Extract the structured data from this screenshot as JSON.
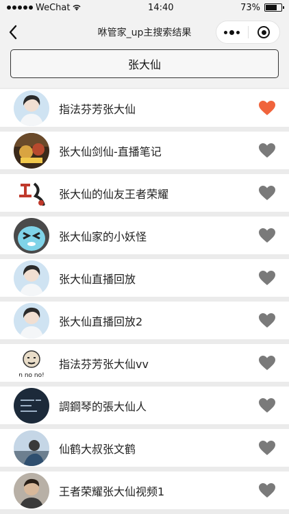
{
  "status": {
    "carrier": "WeChat",
    "time": "14:40",
    "battery": "73%",
    "battery_level": 0.73
  },
  "nav": {
    "title": "咻管家_up主搜索结果",
    "menu_icon": "more-dots-icon",
    "close_icon": "mini-program-close-icon"
  },
  "search": {
    "query": "张大仙"
  },
  "colors": {
    "heart_active": "#f0643c",
    "heart_inactive": "#7a7a7a"
  },
  "results": [
    {
      "name": "指法芬芳张大仙",
      "favorited": true,
      "avatar_icon": "portrait-avatar"
    },
    {
      "name": "张大仙剑仙-直播笔记",
      "favorited": false,
      "avatar_icon": "game-art-avatar"
    },
    {
      "name": "张大仙的仙友王者荣耀",
      "favorited": false,
      "avatar_icon": "calligraphy-avatar"
    },
    {
      "name": "张大仙家的小妖怪",
      "favorited": false,
      "avatar_icon": "cartoon-avatar"
    },
    {
      "name": "张大仙直播回放",
      "favorited": false,
      "avatar_icon": "portrait-avatar"
    },
    {
      "name": "张大仙直播回放2",
      "favorited": false,
      "avatar_icon": "portrait-avatar"
    },
    {
      "name": "指法芬芳张大仙vv",
      "favorited": false,
      "avatar_icon": "meme-avatar"
    },
    {
      "name": "調鋼琴的張大仙人",
      "favorited": false,
      "avatar_icon": "dark-text-avatar"
    },
    {
      "name": "仙鹤大叔张文鹤",
      "favorited": false,
      "avatar_icon": "photo-avatar"
    },
    {
      "name": "王者荣耀张大仙视频1",
      "favorited": false,
      "avatar_icon": "man-avatar"
    }
  ]
}
